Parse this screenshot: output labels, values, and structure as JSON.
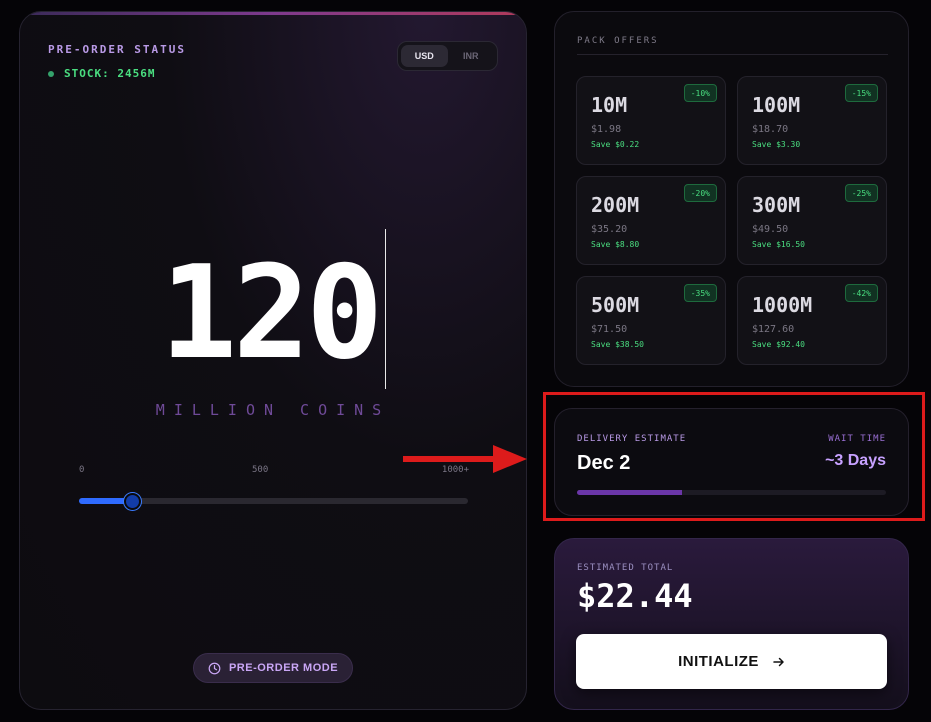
{
  "status": {
    "title": "PRE-ORDER STATUS",
    "stock": "STOCK: 2456M",
    "currency_options": [
      "USD",
      "INR"
    ],
    "currency_selected": "USD"
  },
  "quantity": {
    "value": "120",
    "unit": "MILLION COINS",
    "slider_labels": [
      "0",
      "500",
      "1000+"
    ],
    "slider_fraction": 0.135
  },
  "mode_button": {
    "label": "PRE-ORDER MODE",
    "icon": "clock-icon"
  },
  "offers": {
    "title": "PACK OFFERS",
    "items": [
      {
        "amount": "10M",
        "price": "$1.98",
        "save": "Save $0.22",
        "discount": "-10%"
      },
      {
        "amount": "100M",
        "price": "$18.70",
        "save": "Save $3.30",
        "discount": "-15%"
      },
      {
        "amount": "200M",
        "price": "$35.20",
        "save": "Save $8.80",
        "discount": "-20%"
      },
      {
        "amount": "300M",
        "price": "$49.50",
        "save": "Save $16.50",
        "discount": "-25%"
      },
      {
        "amount": "500M",
        "price": "$71.50",
        "save": "Save $38.50",
        "discount": "-35%"
      },
      {
        "amount": "1000M",
        "price": "$127.60",
        "save": "Save $92.40",
        "discount": "-42%"
      }
    ]
  },
  "delivery": {
    "label": "DELIVERY ESTIMATE",
    "date": "Dec 2",
    "wait_label": "WAIT TIME",
    "wait_value": "~3 Days",
    "progress_fraction": 0.34
  },
  "total": {
    "label": "ESTIMATED TOTAL",
    "amount": "$22.44",
    "button_label": "INITIALIZE"
  },
  "colors": {
    "accent_purple": "#b99ae6",
    "green": "#4ade80",
    "slider_blue": "#2f6bff",
    "highlight_red": "#dd1b1b"
  }
}
